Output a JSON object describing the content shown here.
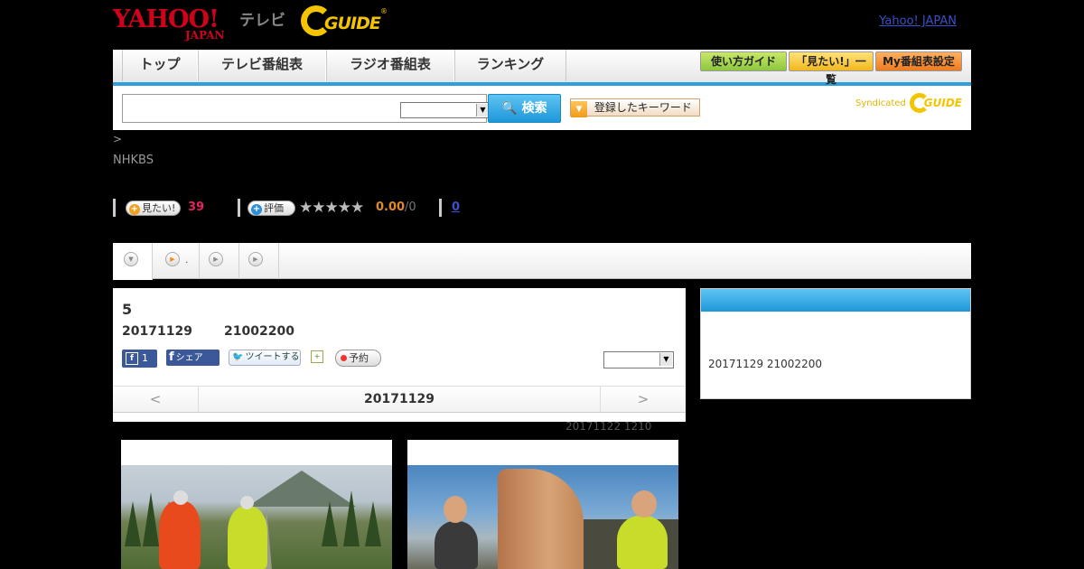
{
  "header": {
    "logo_text": "YAHOO!",
    "logo_sub": "JAPAN",
    "tv_label": "テレビ",
    "gguide_text": "GUIDE",
    "gguide_mark": "®",
    "yahoo_link": "Yahoo! JAPAN"
  },
  "nav": {
    "tabs": [
      {
        "label": "トップ"
      },
      {
        "label": "テレビ番組表"
      },
      {
        "label": "ラジオ番組表"
      },
      {
        "label": "ランキング"
      }
    ],
    "buttons": [
      {
        "label": "使い方ガイド"
      },
      {
        "label": "「見たい!」一覧"
      },
      {
        "label": "My番組表設定"
      }
    ]
  },
  "search": {
    "query": "",
    "button_label": "検索",
    "keyword_label": "登録したキーワード",
    "syndicated": "Syndicated",
    "syndicated_brand": "GUIDE"
  },
  "breadcrumb": ">",
  "channel": "NHKBS",
  "stats": {
    "want_label": "見たい!",
    "want_count": "39",
    "rate_label": "評価",
    "stars": "★★★★★",
    "score": "0.00",
    "score_max": "/0",
    "review_count": "0"
  },
  "subtabs": [
    {
      "icon": "down-arrow-icon",
      "label": ""
    },
    {
      "icon": "play-orange-icon",
      "label": "."
    },
    {
      "icon": "play-icon",
      "label": ""
    },
    {
      "icon": "play-icon",
      "label": ""
    }
  ],
  "program": {
    "title": "5",
    "date": "20171129",
    "time": "21002200",
    "fb_like_count": "1",
    "fb_share_label": "シェア",
    "tweet_label": "ツイートする",
    "reserve_label": "予約",
    "nav_prev": "<",
    "nav_date": "20171129",
    "nav_next": ">",
    "updated": "20171122  1210"
  },
  "sidebar": {
    "text": "20171129  21002200"
  },
  "colors": {
    "accent_blue": "#2aa0dd",
    "yahoo_red": "#d0021b",
    "gguide_yellow": "#f5c400",
    "want_pink": "#e0245e",
    "score_orange": "#e08a2a"
  }
}
